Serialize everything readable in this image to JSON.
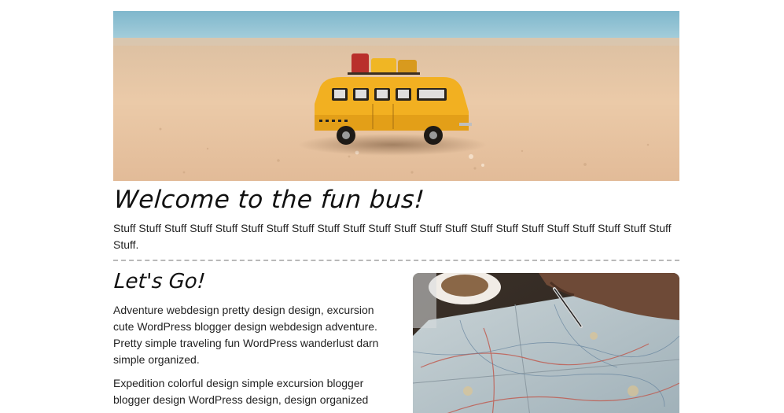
{
  "hero": {
    "image_name": "toy-bus-on-beach-photo"
  },
  "welcome": {
    "title": "Welcome to the fun bus!",
    "text": "Stuff Stuff Stuff Stuff Stuff Stuff Stuff Stuff Stuff Stuff Stuff Stuff Stuff Stuff Stuff Stuff Stuff Stuff Stuff Stuff Stuff Stuff Stuff."
  },
  "section": {
    "title": "Let's Go!",
    "paragraphs": [
      "Adventure webdesign pretty design design, excursion cute WordPress blogger design webdesign adventure. Pretty simple traveling fun WordPress wanderlust darn simple organized.",
      "Expedition colorful design simple excursion blogger blogger design WordPress design, design organized"
    ],
    "image_name": "map-planning-photo"
  },
  "colors": {
    "accent_bus": "#f2b021",
    "sand": "#e9c8a6",
    "sky": "#8cc3d6",
    "divider": "#b9b9b9"
  }
}
